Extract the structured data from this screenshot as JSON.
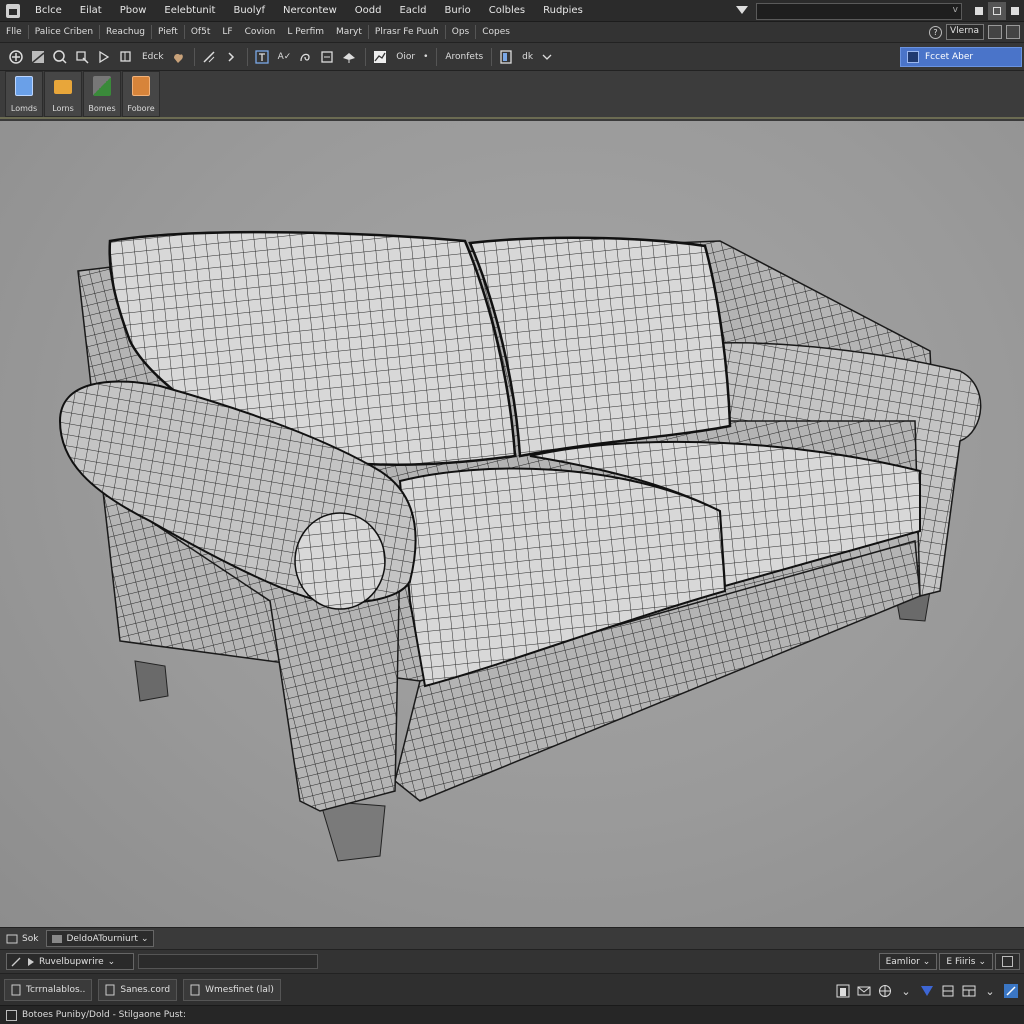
{
  "menubar": {
    "items": [
      "Bclce",
      "Eilat",
      "Pbow",
      "Eelebtunit",
      "Buolyf",
      "Nercontew",
      "Oodd",
      "Eacld",
      "Burio",
      "Colbles",
      "Rudpies"
    ],
    "search_value": "",
    "search_dropdown": "v"
  },
  "toolbar1": {
    "items": [
      "Flle",
      "Palice Criben",
      "Reachug",
      "Pieft",
      "Of5t",
      "LF",
      "Covion",
      "L Perfim",
      "Maryt",
      "Plrasr Fe Puuh",
      "Ops",
      "Copes"
    ],
    "help": "?",
    "view_value": "Vlerna"
  },
  "toolbar2": {
    "label_edit": "Edck",
    "label_av": "A✓",
    "label_ok": "Oior",
    "label_arontets": "Aronfets",
    "label_dk": "dk",
    "panel_tab_label": "Fccet Aber"
  },
  "shelf": {
    "items": [
      {
        "label": "Lomds",
        "color": "#6aa0e8"
      },
      {
        "label": "Lorns",
        "color": "#e8a63a"
      },
      {
        "label": "Bomes",
        "color": "#3a8a3a"
      },
      {
        "label": "Fobore",
        "color": "#d7843a"
      }
    ]
  },
  "bottom1": {
    "label": "Sok",
    "dropdown": "DeldoATourniurt"
  },
  "bottom2": {
    "dropdown": "Ruvelbupwrire",
    "right_dropdown1": "Eamlior",
    "right_dropdown2": "Fiiris"
  },
  "bottom3": {
    "tabs": [
      "Tcrrnalablos..",
      "Sanes.cord",
      "Wmesfinet (lal)"
    ]
  },
  "statusbar": {
    "text": "Botoes Puniby/Dold - Stilgaone Pust:"
  },
  "colors": {
    "accent": "#4a74c9",
    "viewport_bg": "#9a9a9a",
    "panel_bg": "#363636"
  }
}
